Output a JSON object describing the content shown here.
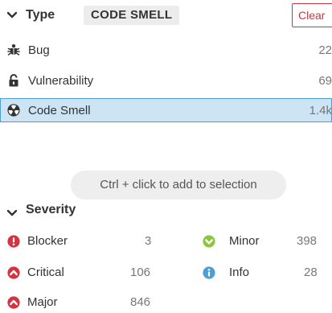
{
  "type_facet": {
    "title": "Type",
    "selected_value": "CODE SMELL",
    "clear_label": "Clear",
    "items": [
      {
        "label": "Bug",
        "count": "22",
        "icon": "bug-icon"
      },
      {
        "label": "Vulnerability",
        "count": "69",
        "icon": "lock-icon"
      },
      {
        "label": "Code Smell",
        "count": "1.4k",
        "icon": "code-smell-icon",
        "selected": true
      }
    ],
    "hint": "Ctrl + click to add to selection"
  },
  "severity_facet": {
    "title": "Severity",
    "items": [
      {
        "label": "Blocker",
        "count": "3",
        "icon": "blocker-icon",
        "color": "#d4333f"
      },
      {
        "label": "Minor",
        "count": "398",
        "icon": "minor-icon",
        "color": "#8cc63f"
      },
      {
        "label": "Critical",
        "count": "106",
        "icon": "critical-icon",
        "color": "#d4333f"
      },
      {
        "label": "Info",
        "count": "28",
        "icon": "info-icon",
        "color": "#4b9fd5"
      },
      {
        "label": "Major",
        "count": "846",
        "icon": "major-icon",
        "color": "#d4333f"
      }
    ]
  },
  "colors": {
    "accent": "#4b9fd5",
    "selected_bg": "#cde4f5",
    "danger": "#d4333f",
    "success": "#8cc63f"
  }
}
